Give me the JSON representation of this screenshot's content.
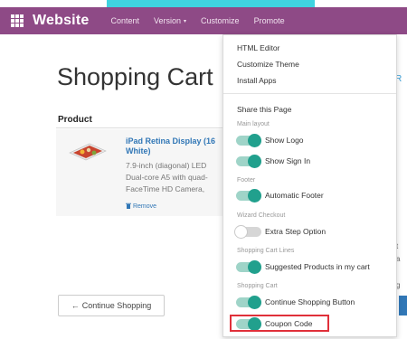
{
  "navbar": {
    "brand": "Website",
    "menu": [
      {
        "label": "Content",
        "has_caret": false
      },
      {
        "label": "Version",
        "has_caret": true
      },
      {
        "label": "Customize",
        "has_caret": false
      },
      {
        "label": "Promote",
        "has_caret": false
      }
    ],
    "caret_glyph": "▾",
    "colors": {
      "bar": "#8e4a86",
      "strip": "#3fd3e0"
    }
  },
  "page": {
    "title": "Shopping Cart",
    "table_header": "Product",
    "right_edge_glyph": "R"
  },
  "product": {
    "name_line1": "iPad Retina Display (16",
    "name_line2": "White)",
    "description": [
      "7.9-inch (diagonal) LED",
      "Dual-core A5 with quad-",
      "FaceTime HD Camera,"
    ],
    "remove_label": "Remove",
    "remove_icon": "trash-icon"
  },
  "continue_button": {
    "label": "Continue Shopping",
    "icon": "left-arrow-icon",
    "arrow_glyph": "←"
  },
  "right_edge": {
    "line1": "t",
    "line2": "a",
    "line3": "g"
  },
  "dropdown": {
    "items": [
      "HTML Editor",
      "Customize Theme",
      "Install Apps"
    ],
    "share_label": "Share this Page",
    "sections": [
      {
        "header": "Main layout",
        "toggles": [
          {
            "label": "Show Logo",
            "on": true
          },
          {
            "label": "Show Sign In",
            "on": true
          }
        ]
      },
      {
        "header": "Footer",
        "toggles": [
          {
            "label": "Automatic Footer",
            "on": true
          }
        ]
      },
      {
        "header": "Wizard Checkout",
        "toggles": [
          {
            "label": "Extra Step Option",
            "on": false
          }
        ]
      },
      {
        "header": "Shopping Cart Lines",
        "toggles": [
          {
            "label": "Suggested Products in my cart",
            "on": true
          }
        ]
      },
      {
        "header": "Shopping Cart",
        "toggles": [
          {
            "label": "Continue Shopping Button",
            "on": true
          },
          {
            "label": "Coupon Code",
            "on": true,
            "highlighted": true
          }
        ]
      }
    ],
    "colors": {
      "toggle_on_track": "#9fd4c8",
      "toggle_on_knob": "#21a08d",
      "highlight": "#e0303a"
    }
  }
}
